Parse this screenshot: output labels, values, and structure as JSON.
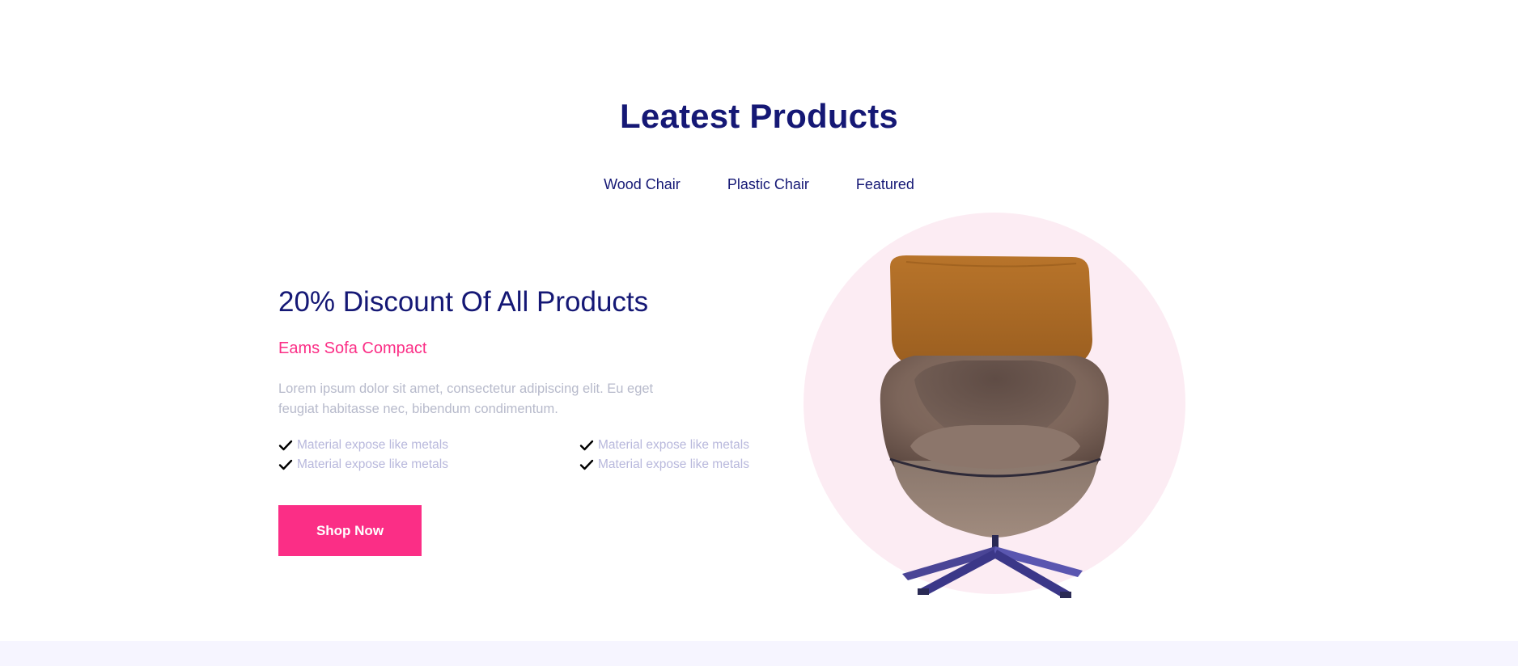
{
  "section": {
    "title": "Leatest Products"
  },
  "tabs": [
    {
      "label": "Wood Chair"
    },
    {
      "label": "Plastic Chair"
    },
    {
      "label": "Featured"
    }
  ],
  "offer": {
    "title": "20% Discount Of All Products",
    "subtitle": "Eams Sofa Compact",
    "description": "Lorem ipsum dolor sit amet, consectetur adipiscing elit. Eu eget feugiat habitasse nec, bibendum condimentum.",
    "features": [
      {
        "label": "Material expose like metals",
        "icon": "check-icon"
      },
      {
        "label": "Material expose like metals",
        "icon": "check-icon"
      },
      {
        "label": "Material expose like metals",
        "icon": "check-icon"
      },
      {
        "label": "Material expose like metals",
        "icon": "check-icon"
      }
    ],
    "cta_label": "Shop Now"
  },
  "product_image": {
    "icon": "armchair-image"
  },
  "colors": {
    "navy": "#151875",
    "pink": "#FB2E86",
    "circle_bg": "#FCECF3",
    "muted": "#B7BACB",
    "footer_bg": "#F6F5FF"
  }
}
